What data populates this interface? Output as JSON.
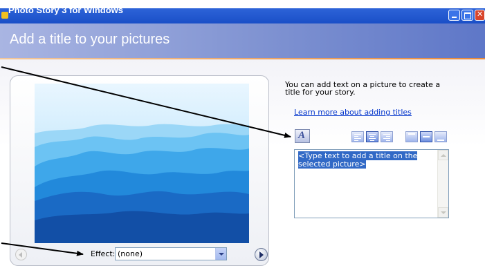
{
  "window": {
    "title": "Photo Story 3 for Windows",
    "buttons": [
      "minimize",
      "maximize",
      "close"
    ]
  },
  "header": {
    "title": "Add a title to your pictures"
  },
  "preview": {
    "image_subject": "layered blue mountain ridges",
    "effect_label": "Effect:",
    "effect_value": "(none)"
  },
  "side_panel": {
    "description": "You can add text on a picture to create a title for your story.",
    "learn_more_link": "Learn more about adding titles",
    "title_text": "<Type text to add a title on the selected picture>"
  },
  "toolbar": {
    "font_icon": "font-select-icon",
    "horizontal_alignment": [
      "align-left-icon",
      "align-center-icon",
      "align-right-icon"
    ],
    "selected_horizontal": "align-center-icon",
    "vertical_alignment": [
      "align-top-icon",
      "align-middle-icon",
      "align-bottom-icon"
    ],
    "selected_vertical": "align-middle-icon"
  },
  "colors": {
    "titlebar": "#1f57cc",
    "header": "#7b8fd0",
    "accent_line": "#e98a3a",
    "link": "#0033cc",
    "selection": "#3169c6"
  }
}
